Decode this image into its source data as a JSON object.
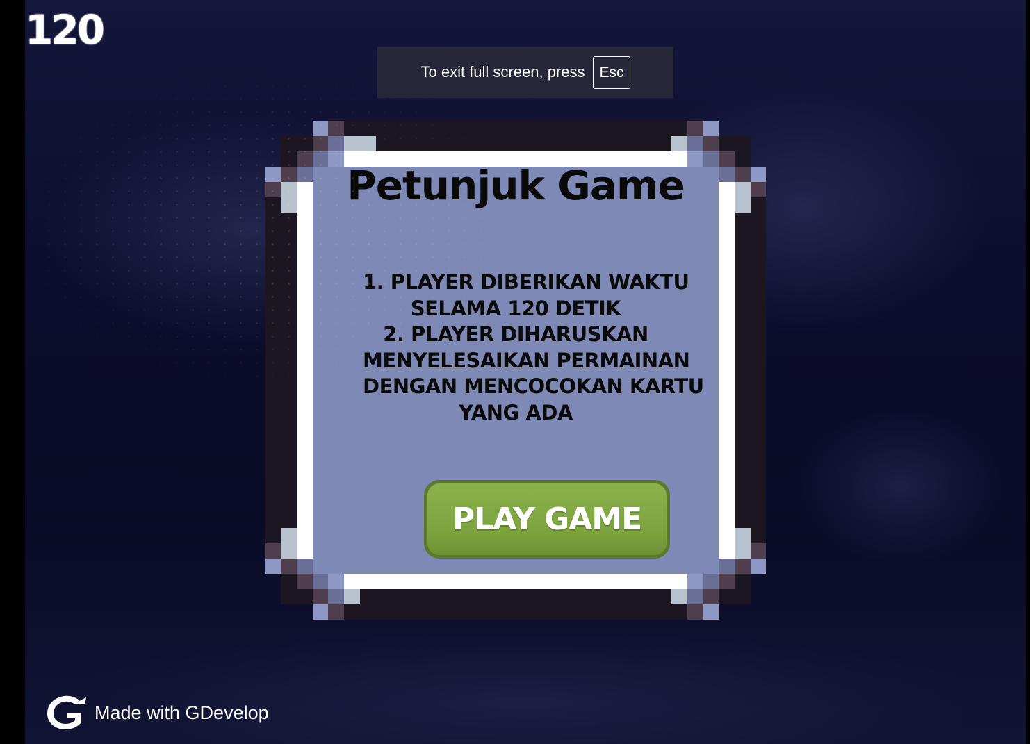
{
  "hud": {
    "timer": "120"
  },
  "fullscreen_notice": {
    "text": "To exit full screen, press",
    "key": "Esc"
  },
  "dialog": {
    "title": "Petunjuk Game",
    "instructions": [
      "1. Player diberikan waktu",
      "selama 120 detik",
      "2. Player diharuskan",
      "menyelesaikan permainan",
      "dengan mencocokan kartu",
      "yang ada"
    ],
    "button_label": "PLAY GAME"
  },
  "footer": {
    "badge_text": "Made with GDevelop",
    "logo_icon": "gdevelop-logo-icon"
  },
  "colors": {
    "panel_fill": "#7e89b5",
    "panel_border": "#1c1620",
    "button_fill": "#7ca23e",
    "button_border": "#5c7a2d",
    "background": "#0c0d2c"
  }
}
